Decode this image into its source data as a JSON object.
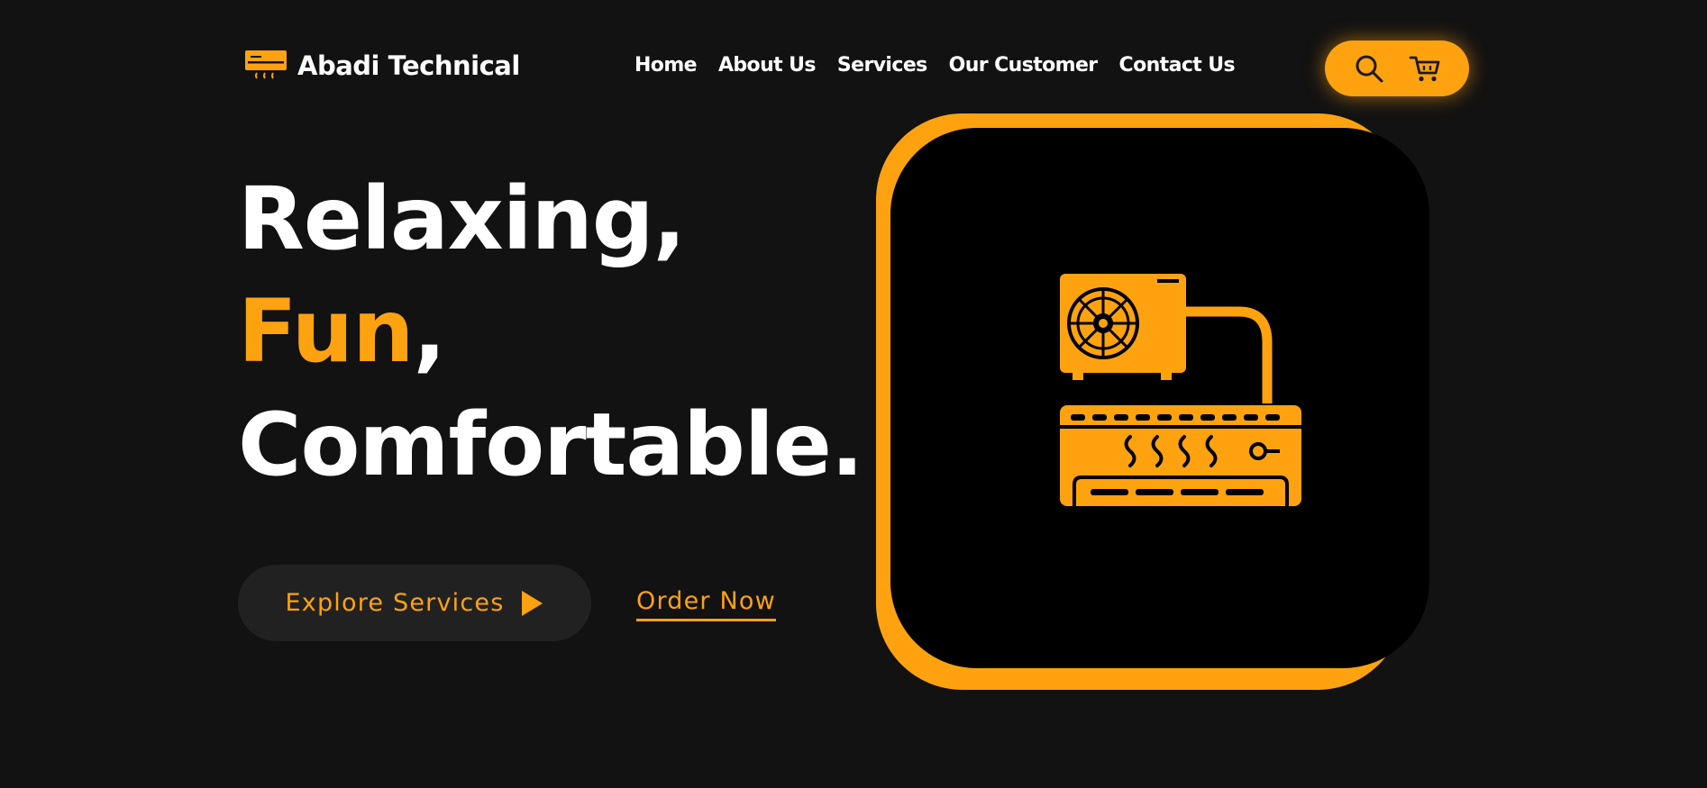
{
  "brand": {
    "name": "Abadi Technical",
    "icon": "air-conditioner-icon"
  },
  "nav": {
    "items": [
      {
        "label": "Home"
      },
      {
        "label": "About Us"
      },
      {
        "label": "Services"
      },
      {
        "label": "Our Customer"
      },
      {
        "label": "Contact Us"
      }
    ]
  },
  "header_actions": {
    "search_icon": "search-icon",
    "cart_icon": "cart-icon"
  },
  "hero": {
    "line1": "Relaxing,",
    "line2_accent": "Fun",
    "line2_rest": ",",
    "line3": "Comfortable.",
    "explore_label": "Explore Services",
    "explore_icon": "play-icon",
    "order_label": "Order Now",
    "illustration": "air-conditioner-unit-icon"
  },
  "colors": {
    "background": "#121212",
    "accent": "#ffa210",
    "text": "#ffffff",
    "button_bg": "#212121",
    "card_bg": "#000000"
  }
}
